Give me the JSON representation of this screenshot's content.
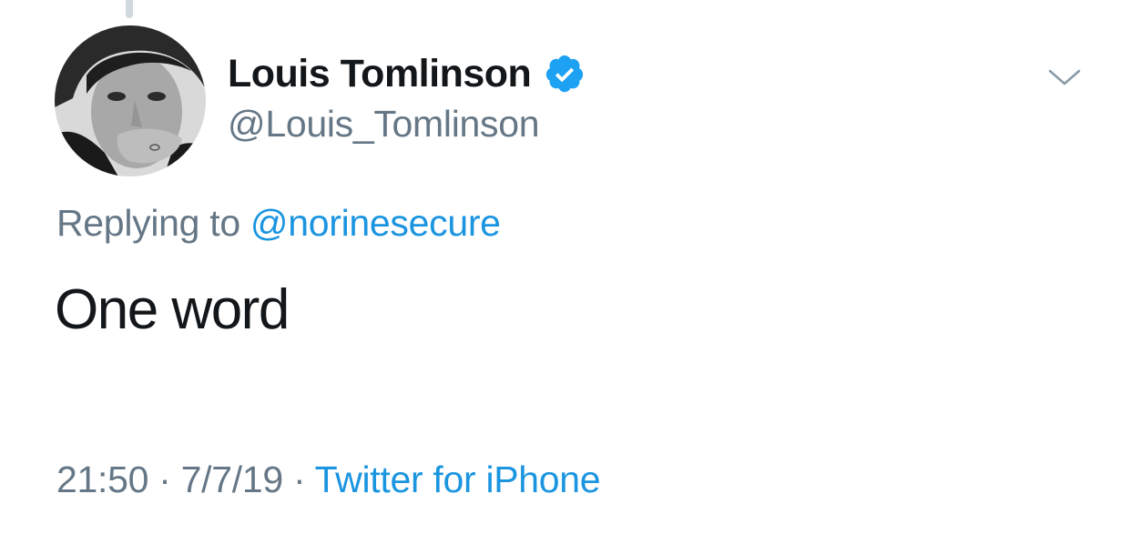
{
  "author": {
    "display_name": "Louis Tomlinson",
    "handle": "@Louis_Tomlinson",
    "verified": true,
    "verified_icon": "verified-badge-icon"
  },
  "reply": {
    "prefix": "Replying to",
    "mention": "@norinesecure"
  },
  "tweet": {
    "text": "One word"
  },
  "meta": {
    "time": "21:50",
    "separator": "·",
    "date": "7/7/19",
    "source": "Twitter for iPhone"
  },
  "menu": {
    "icon": "chevron-down-icon"
  },
  "colors": {
    "link": "#1b95e0",
    "secondary_text": "#657786",
    "primary_text": "#14171a",
    "verified_badge": "#1da1f2"
  }
}
